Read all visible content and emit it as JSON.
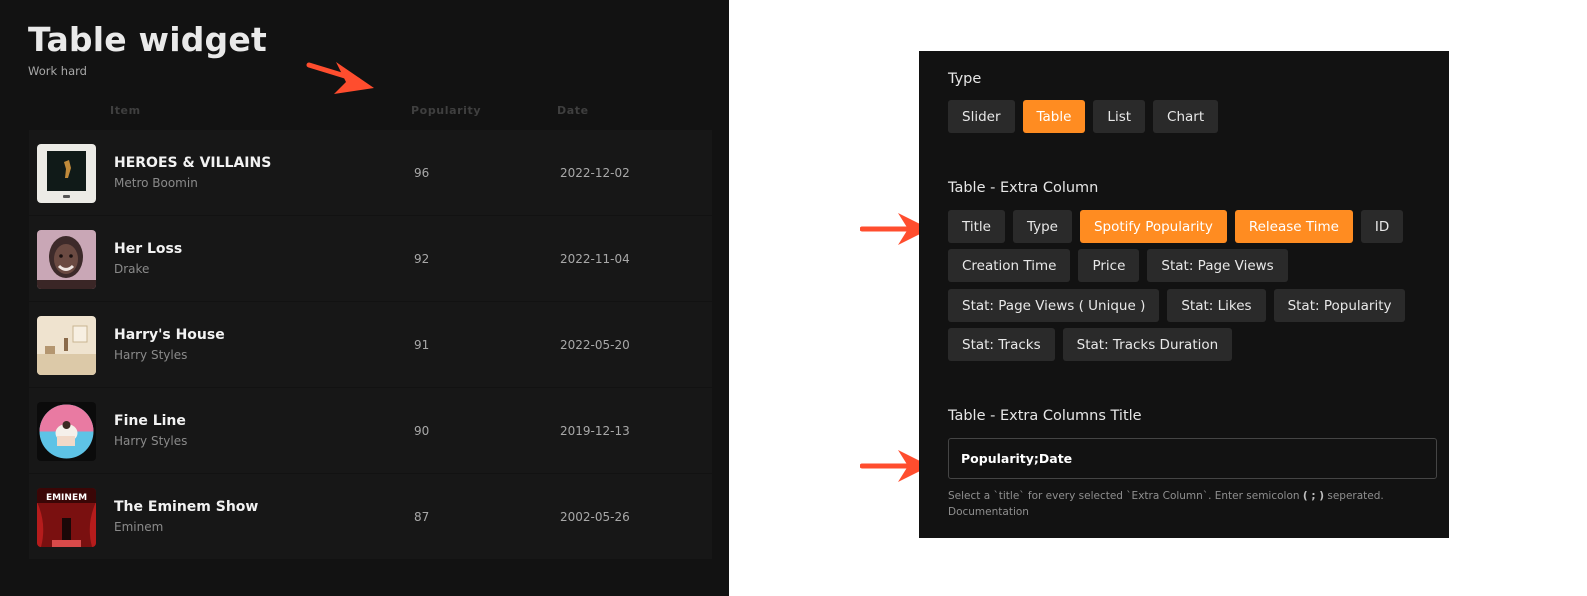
{
  "left": {
    "title": "Table widget",
    "subtitle": "Work hard",
    "columns": {
      "item": "Item",
      "popularity": "Popularity",
      "date": "Date"
    },
    "rows": [
      {
        "title": "HEROES & VILLAINS",
        "artist": "Metro Boomin",
        "popularity": "96",
        "date": "2022-12-02"
      },
      {
        "title": "Her Loss",
        "artist": "Drake",
        "popularity": "92",
        "date": "2022-11-04"
      },
      {
        "title": "Harry's House",
        "artist": "Harry Styles",
        "popularity": "91",
        "date": "2022-05-20"
      },
      {
        "title": "Fine Line",
        "artist": "Harry Styles",
        "popularity": "90",
        "date": "2019-12-13"
      },
      {
        "title": "The Eminem Show",
        "artist": "Eminem",
        "popularity": "87",
        "date": "2002-05-26"
      }
    ],
    "cover_text": {
      "eminem": "EMINEM"
    }
  },
  "right": {
    "type_label": "Type",
    "types": [
      {
        "label": "Slider",
        "active": false
      },
      {
        "label": "Table",
        "active": true
      },
      {
        "label": "List",
        "active": false
      },
      {
        "label": "Chart",
        "active": false
      }
    ],
    "extra_column_label": "Table - Extra Column",
    "extra_columns": [
      {
        "label": "Title",
        "active": false
      },
      {
        "label": "Type",
        "active": false
      },
      {
        "label": "Spotify Popularity",
        "active": true
      },
      {
        "label": "Release Time",
        "active": true
      },
      {
        "label": "ID",
        "active": false
      },
      {
        "label": "Creation Time",
        "active": false
      },
      {
        "label": "Price",
        "active": false
      },
      {
        "label": "Stat: Page Views",
        "active": false
      },
      {
        "label": "Stat: Page Views ( Unique )",
        "active": false
      },
      {
        "label": "Stat: Likes",
        "active": false
      },
      {
        "label": "Stat: Popularity",
        "active": false
      },
      {
        "label": "Stat: Tracks",
        "active": false
      },
      {
        "label": "Stat: Tracks Duration",
        "active": false
      }
    ],
    "extra_columns_title_label": "Table - Extra Columns Title",
    "extra_columns_title_value": "Popularity;Date",
    "help_text_before": "Select a `title` for every selected `Extra Column`. Enter semicolon",
    "help_text_semicolon": "( ; )",
    "help_text_after": "seperated.",
    "help_link": "Documentation"
  },
  "colors": {
    "accent": "#ff8c21",
    "arrow": "#ff4d2e",
    "panel": "#121212",
    "row": "#171717"
  },
  "icons": [
    "arrow-right-icon"
  ]
}
